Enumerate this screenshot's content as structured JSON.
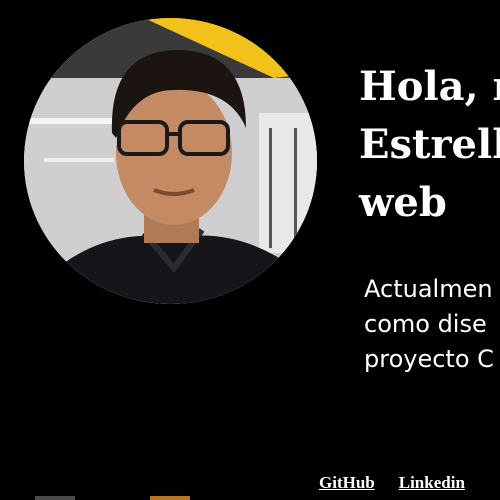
{
  "hero": {
    "title_lines": [
      "Hola, m",
      "Estrella",
      "web"
    ],
    "intro_lines": [
      "Actualmen",
      "como dise",
      "proyecto C"
    ]
  },
  "avatar": {
    "label": "profile-photo"
  },
  "links": {
    "github": "GitHub",
    "linkedin": "Linkedin"
  },
  "colors": {
    "background": "#000000",
    "text": "#ffffff"
  }
}
